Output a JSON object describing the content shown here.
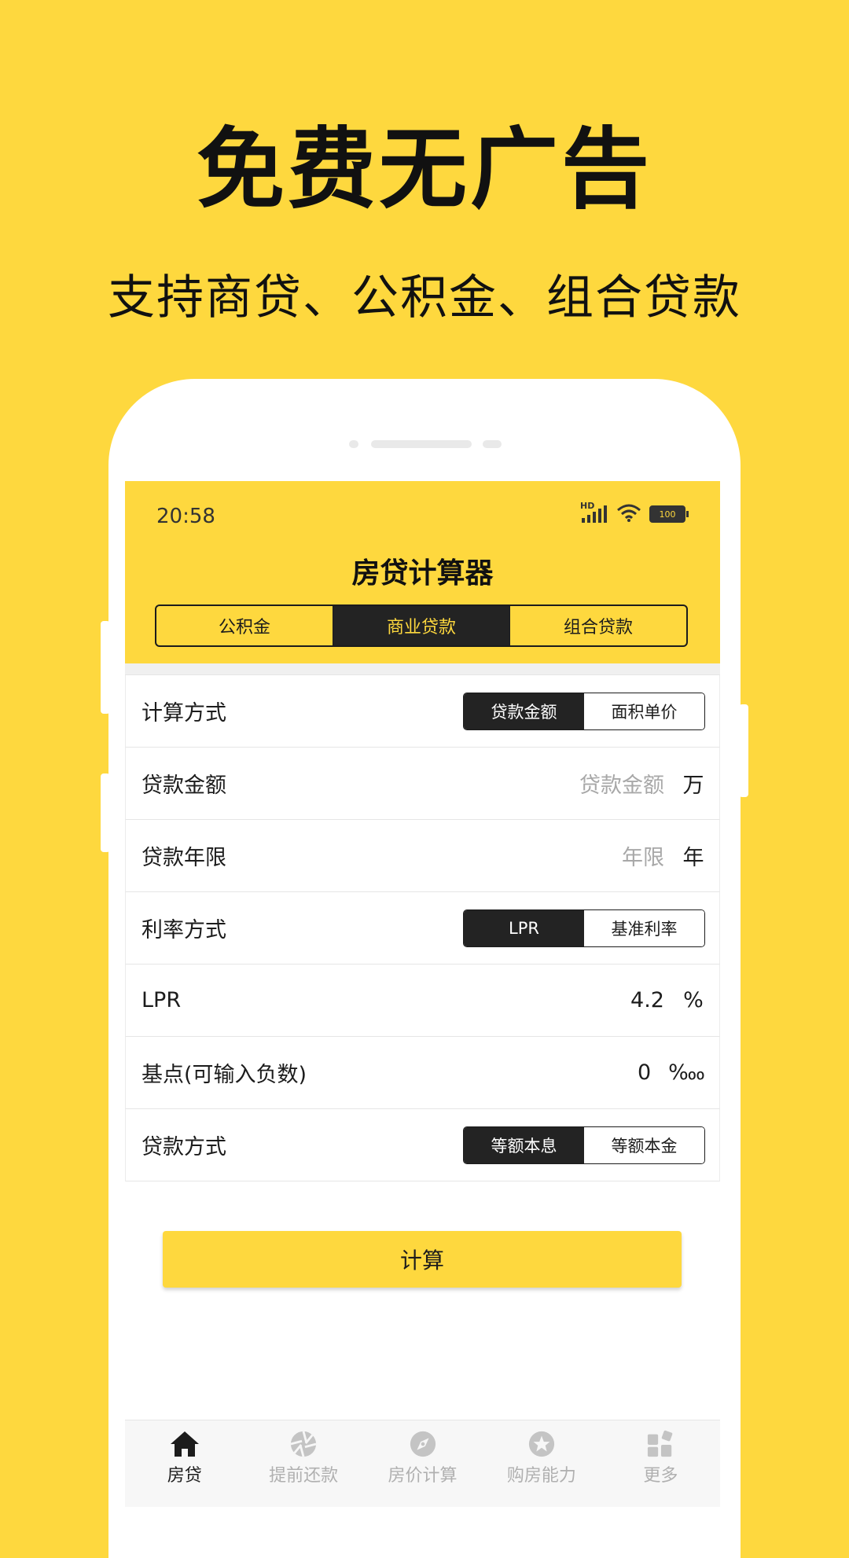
{
  "promo": {
    "headline": "免费无广告",
    "subline": "支持商贷、公积金、组合贷款"
  },
  "status_bar": {
    "time": "20:58",
    "network_label": "HD",
    "battery": "100"
  },
  "header": {
    "title": "房贷计算器",
    "tabs": [
      {
        "label": "公积金",
        "active": false
      },
      {
        "label": "商业贷款",
        "active": true
      },
      {
        "label": "组合贷款",
        "active": false
      }
    ]
  },
  "form": {
    "calc_method": {
      "label": "计算方式",
      "options": [
        "贷款金额",
        "面积单价"
      ],
      "selected": "贷款金额"
    },
    "loan_amount": {
      "label": "贷款金额",
      "placeholder": "贷款金额",
      "unit": "万"
    },
    "loan_term": {
      "label": "贷款年限",
      "placeholder": "年限",
      "unit": "年"
    },
    "rate_method": {
      "label": "利率方式",
      "options": [
        "LPR",
        "基准利率"
      ],
      "selected": "LPR"
    },
    "lpr": {
      "label": "LPR",
      "value": "4.2",
      "unit": "%"
    },
    "basis_points": {
      "label": "基点(可输入负数)",
      "value": "0",
      "unit": "‱"
    },
    "repay_method": {
      "label": "贷款方式",
      "options": [
        "等额本息",
        "等额本金"
      ],
      "selected": "等额本息"
    }
  },
  "calculate_label": "计算",
  "bottom_nav": [
    {
      "label": "房贷",
      "icon": "home-icon",
      "active": true
    },
    {
      "label": "提前还款",
      "icon": "aperture-icon",
      "active": false
    },
    {
      "label": "房价计算",
      "icon": "compass-icon",
      "active": false
    },
    {
      "label": "购房能力",
      "icon": "star-icon",
      "active": false
    },
    {
      "label": "更多",
      "icon": "grid-icon",
      "active": false
    }
  ],
  "colors": {
    "brand_yellow": "#FED83E",
    "dark": "#232323"
  }
}
